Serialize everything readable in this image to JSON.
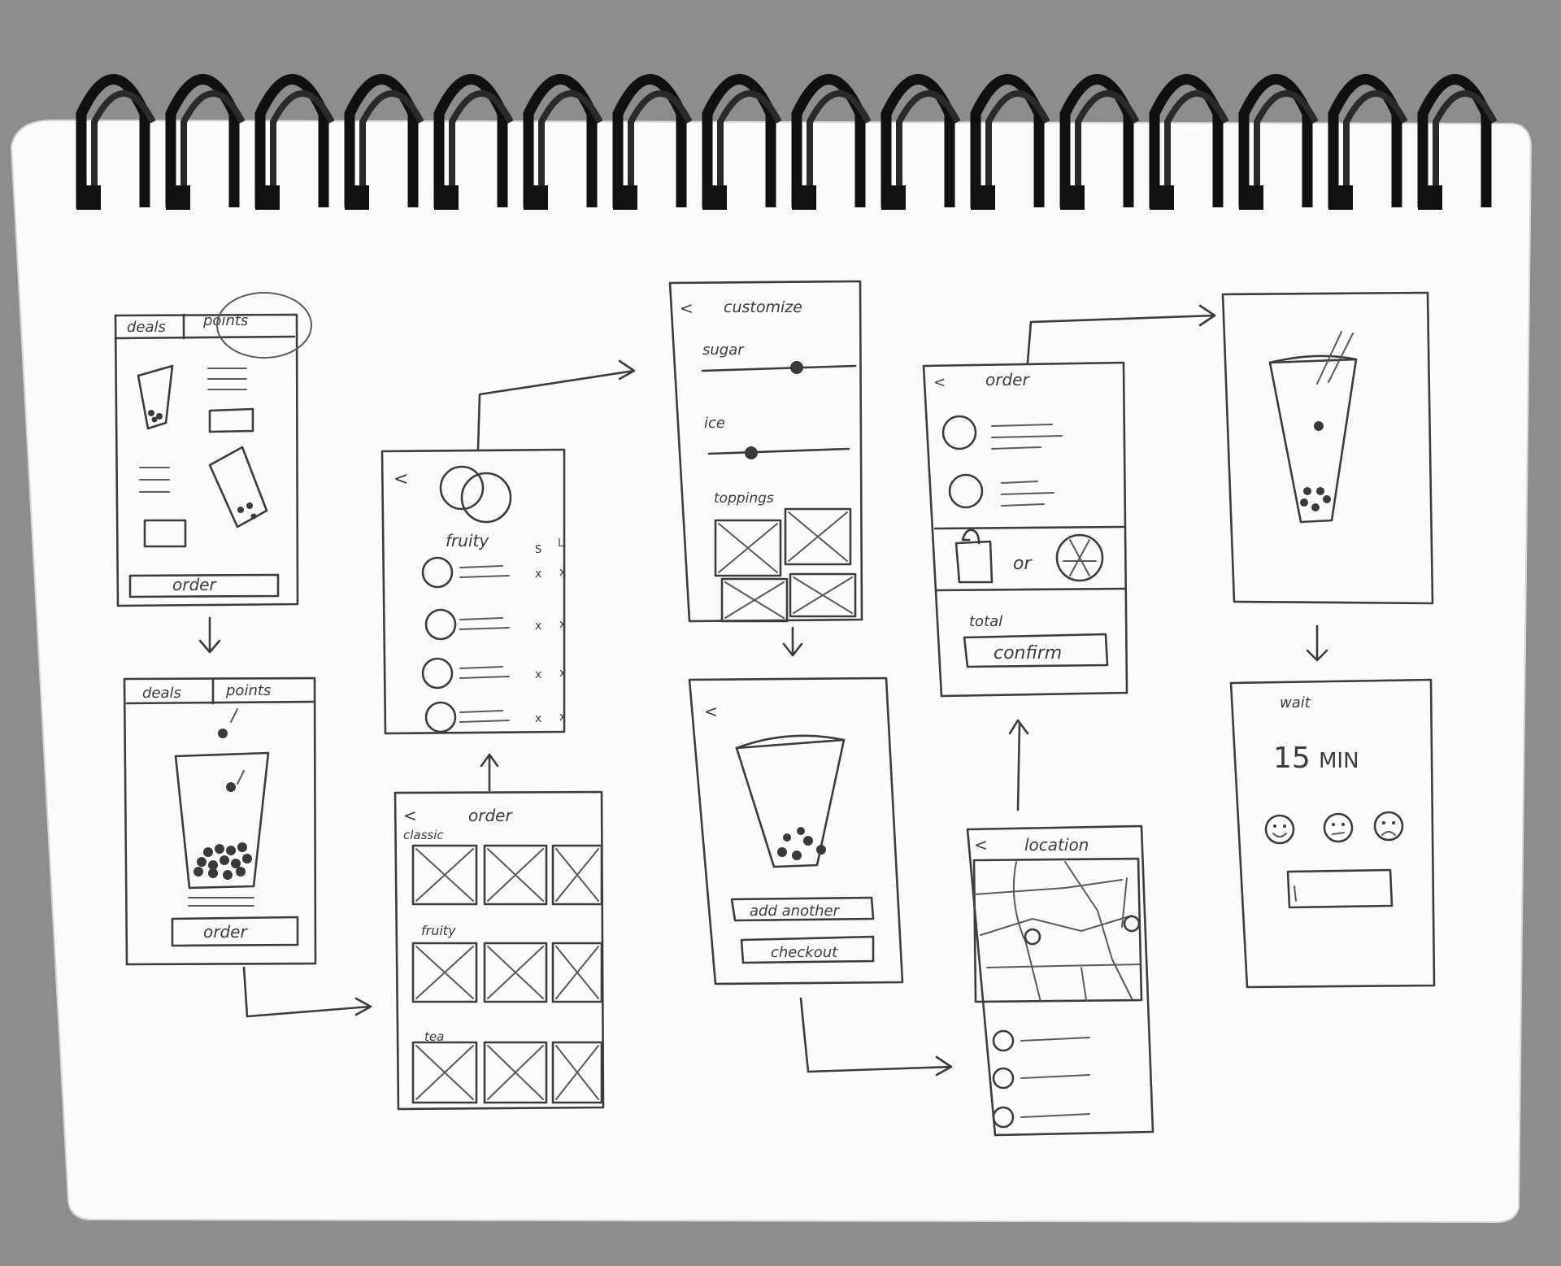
{
  "screens": {
    "home": {
      "tab_deals": "deals",
      "tab_points": "points",
      "order_button": "order"
    },
    "points": {
      "tab_deals": "deals",
      "tab_points": "points",
      "order_button": "order"
    },
    "drink_detail": {
      "back": "<",
      "category": "fruity",
      "size_small": "S",
      "size_large": "L",
      "mark": "x"
    },
    "menu": {
      "back": "<",
      "title": "order",
      "sections": [
        "classic",
        "fruity",
        "tea"
      ]
    },
    "customize": {
      "back": "<",
      "title": "customize",
      "sugar": "sugar",
      "ice": "ice",
      "toppings": "toppings"
    },
    "added": {
      "back": "<",
      "add_another": "add another",
      "checkout": "checkout"
    },
    "review": {
      "back": "<",
      "title": "order",
      "or": "or",
      "total": "total",
      "confirm": "confirm"
    },
    "location": {
      "back": "<",
      "title": "location"
    },
    "wait": {
      "title": "wait",
      "minutes": "15",
      "unit": "MIN"
    }
  },
  "colors": {
    "paper": "#fbfbfb",
    "pencil": "#3c3c3c",
    "rings": "#0f0f0f",
    "background": "#8d8d8d"
  }
}
